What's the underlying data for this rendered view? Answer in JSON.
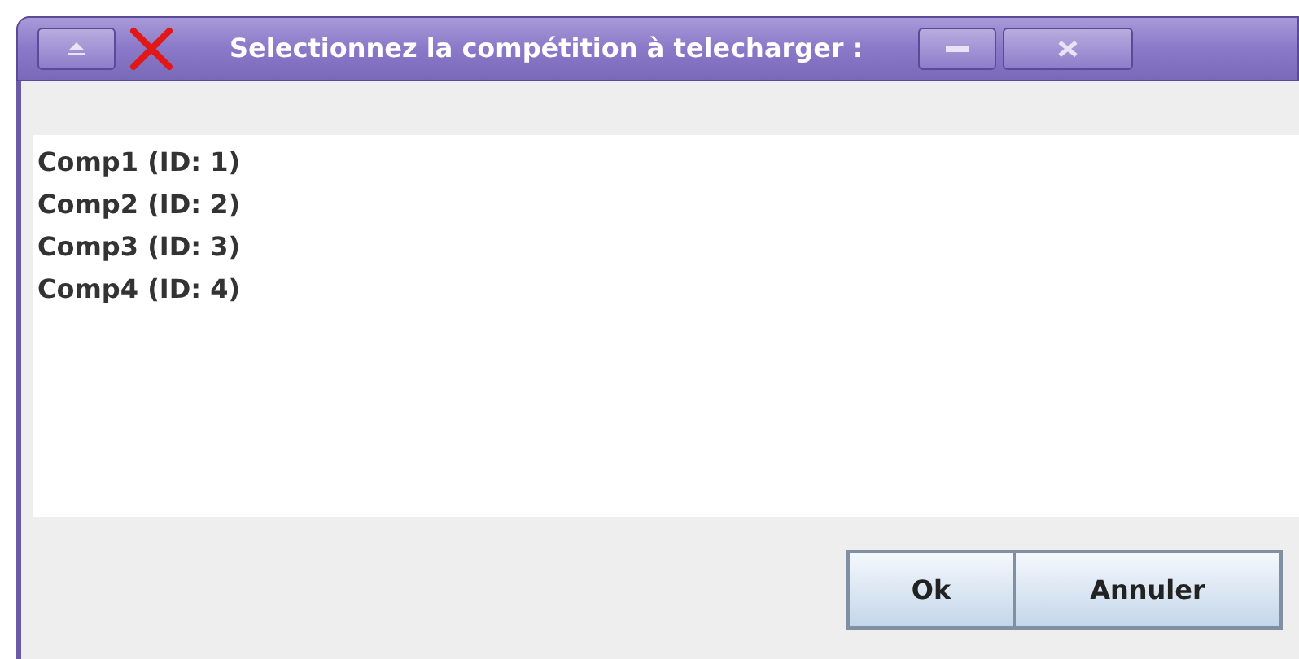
{
  "window": {
    "title": "Selectionnez la compétition à telecharger :"
  },
  "list": {
    "items": [
      "Comp1 (ID: 1)",
      "Comp2 (ID: 2)",
      "Comp3 (ID: 3)",
      "Comp4 (ID: 4)"
    ]
  },
  "buttons": [
    "Ok",
    "Annuler"
  ]
}
